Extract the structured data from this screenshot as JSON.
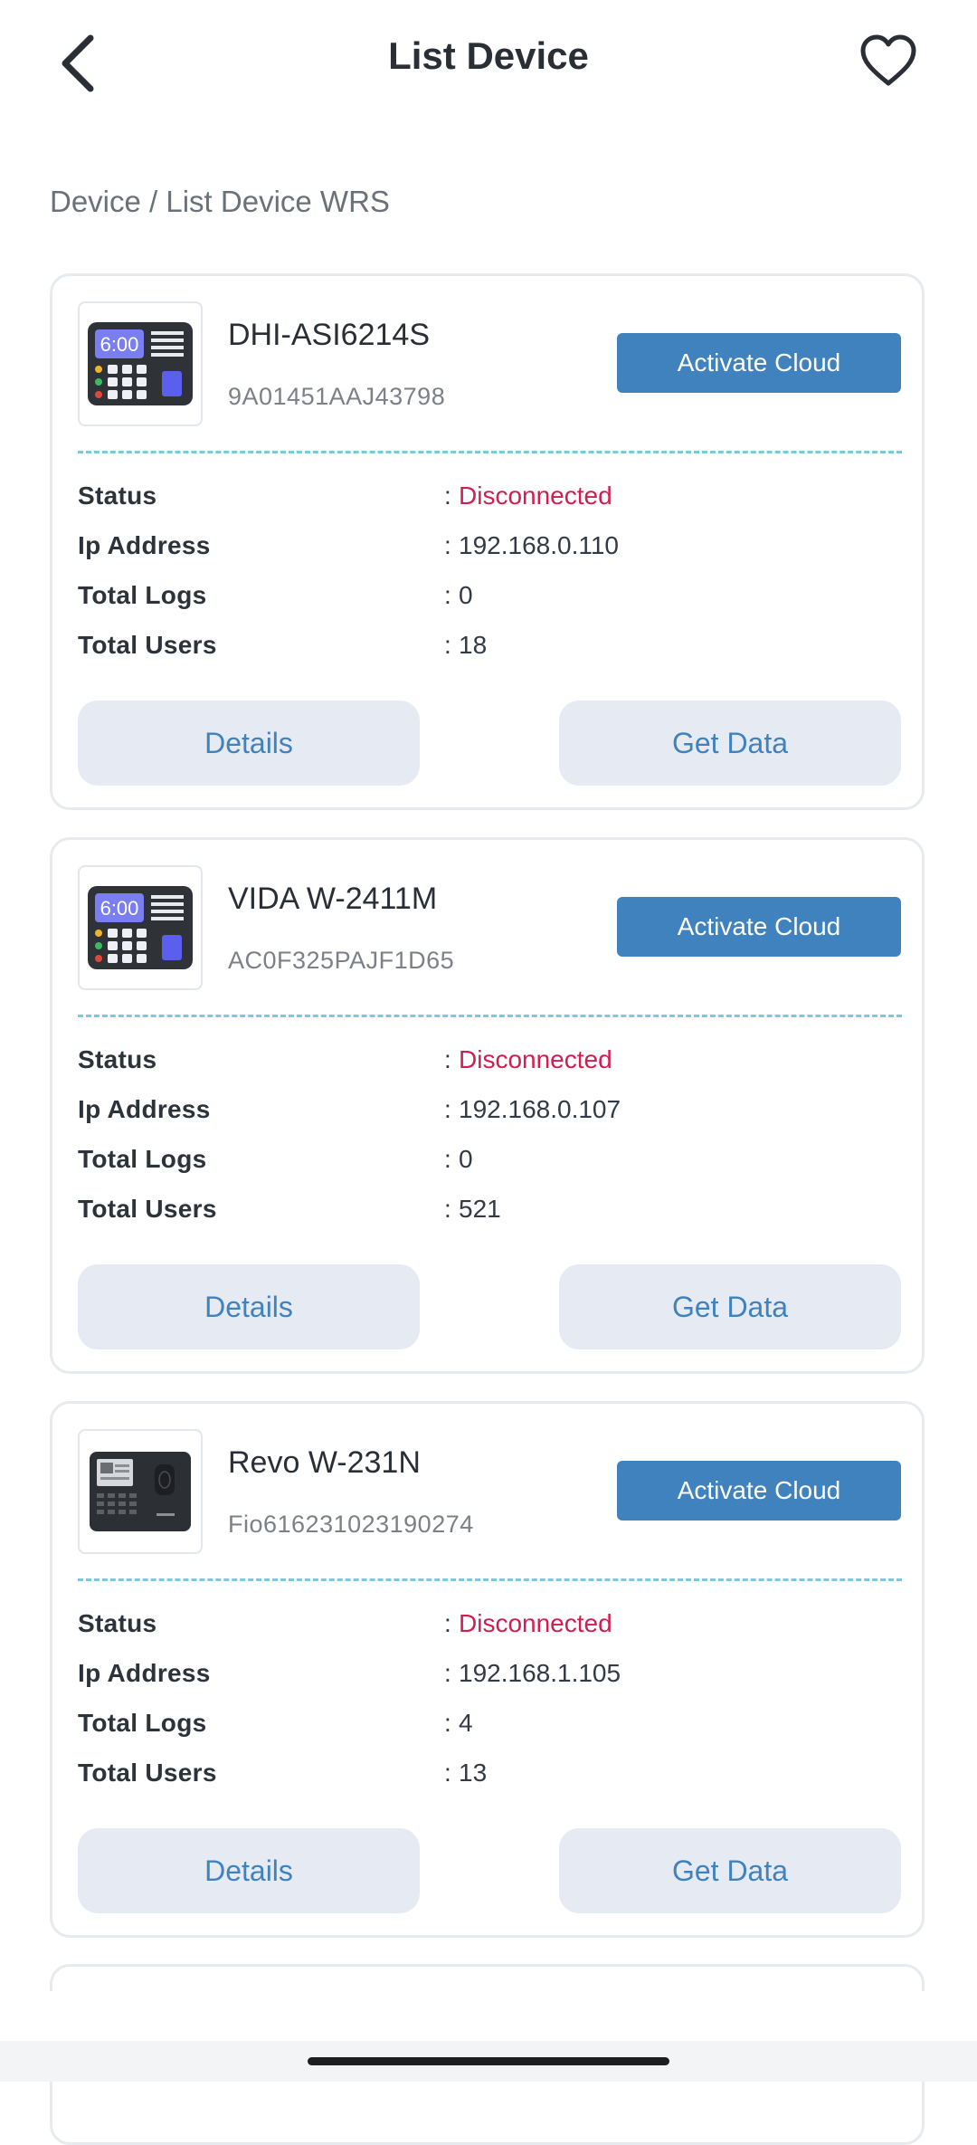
{
  "header": {
    "title": "List Device",
    "back_icon": "chevron-left-icon",
    "favorite_icon": "heart-outline-icon"
  },
  "breadcrumb": "Device / List Device WRS",
  "labels": {
    "status": "Status",
    "ip": "Ip Address",
    "logs": "Total Logs",
    "users": "Total Users",
    "activate": "Activate Cloud",
    "details": "Details",
    "get_data": "Get Data",
    "colon": ":"
  },
  "colors": {
    "primary": "#3f82bd",
    "status_disconnected": "#d21d4e",
    "secondary_button_bg": "#e6ebf3",
    "divider": "#7cc9dd"
  },
  "devices": [
    {
      "name": "DHI-ASI6214S",
      "serial": "9A01451AAJ43798",
      "status": "Disconnected",
      "ip": "192.168.0.110",
      "logs": "0",
      "users": "18",
      "image": "time-attendance-keypad-icon",
      "clock": "6:00"
    },
    {
      "name": "VIDA W-2411M",
      "serial": "AC0F325PAJF1D65",
      "status": "Disconnected",
      "ip": "192.168.0.107",
      "logs": "0",
      "users": "521",
      "image": "time-attendance-keypad-icon",
      "clock": "6:00"
    },
    {
      "name": "Revo W-231N",
      "serial": "Fio616231023190274",
      "status": "Disconnected",
      "ip": "192.168.1.105",
      "logs": "4",
      "users": "13",
      "image": "fingerprint-terminal-icon"
    }
  ]
}
